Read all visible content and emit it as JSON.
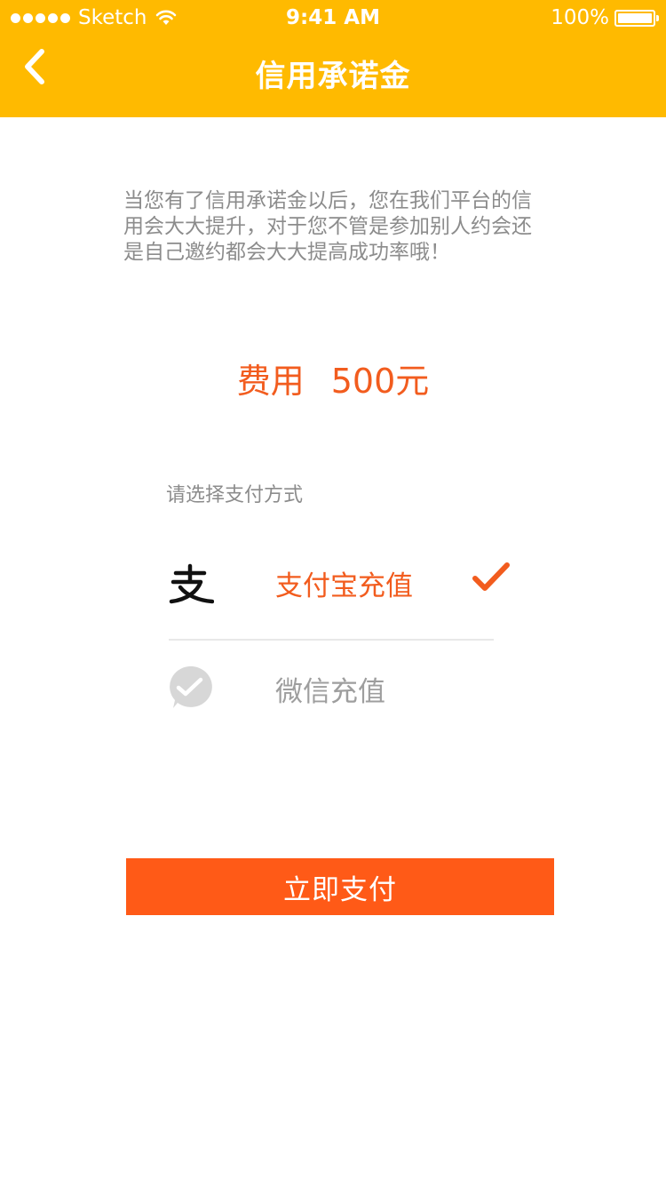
{
  "status_bar": {
    "carrier": "Sketch",
    "time": "9:41 AM",
    "battery": "100%"
  },
  "header": {
    "title": "信用承诺金",
    "back_icon": "chevron-left-icon"
  },
  "description": "当您有了信用承诺金以后，您在我们平台的信用会大大提升，对于您不管是参加别人约会还是自己邀约都会大大提高成功率哦！",
  "fee": {
    "label": "费用",
    "amount": "500元"
  },
  "payment": {
    "prompt": "请选择支付方式",
    "options": [
      {
        "label": "支付宝充值",
        "icon": "alipay-icon",
        "selected": true
      },
      {
        "label": "微信充值",
        "icon": "wechat-icon",
        "selected": false
      }
    ]
  },
  "submit_label": "立即支付",
  "colors": {
    "header": "#FFBA00",
    "accent": "#F25C1E",
    "button": "#FF5A17"
  }
}
